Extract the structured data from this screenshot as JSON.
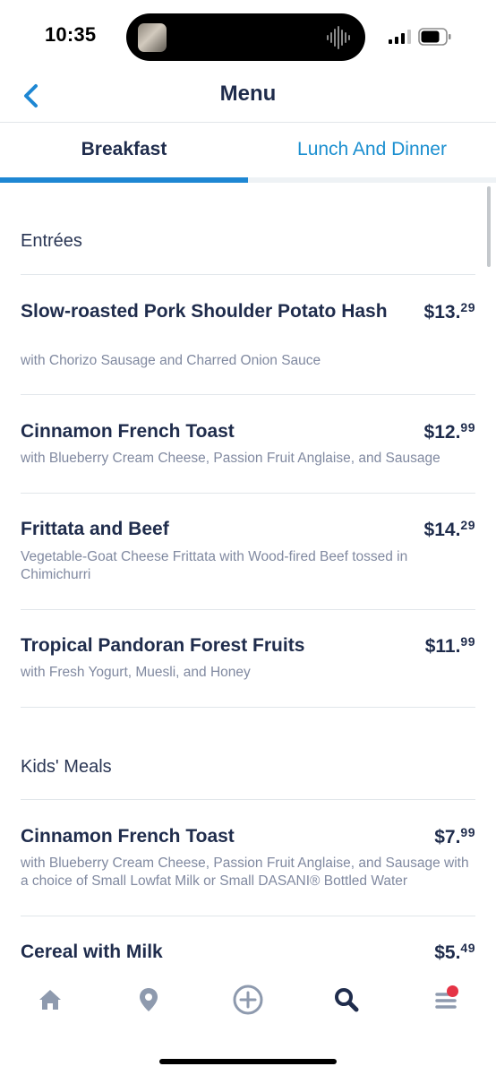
{
  "status_bar": {
    "time": "10:35"
  },
  "header": {
    "title": "Menu"
  },
  "tabs": [
    {
      "label": "Breakfast",
      "selected": true
    },
    {
      "label": "Lunch And Dinner",
      "selected": false
    }
  ],
  "sections": [
    {
      "heading": "Entrées",
      "items": [
        {
          "name": "Slow-roasted Pork Shoulder Potato Hash",
          "price_dollars": "$13.",
          "price_cents": "29",
          "description": "with Chorizo Sausage and Charred Onion Sauce"
        },
        {
          "name": "Cinnamon French Toast",
          "price_dollars": "$12.",
          "price_cents": "99",
          "description": "with Blueberry Cream Cheese, Passion Fruit Anglaise, and Sausage"
        },
        {
          "name": "Frittata and Beef",
          "price_dollars": "$14.",
          "price_cents": "29",
          "description": "Vegetable-Goat Cheese Frittata with Wood-fired Beef tossed in Chimichurri"
        },
        {
          "name": "Tropical Pandoran Forest Fruits",
          "price_dollars": "$11.",
          "price_cents": "99",
          "description": "with Fresh Yogurt, Muesli, and Honey"
        }
      ]
    },
    {
      "heading": "Kids' Meals",
      "items": [
        {
          "name": "Cinnamon French Toast",
          "price_dollars": "$7.",
          "price_cents": "99",
          "description": "with Blueberry Cream Cheese, Passion Fruit Anglaise, and Sausage with a choice of Small Lowfat Milk or Small DASANI® Bottled Water"
        },
        {
          "name": "Cereal with Milk",
          "price_dollars": "$5.",
          "price_cents": "49",
          "description": ""
        }
      ]
    }
  ],
  "tab_bar": {
    "items": [
      {
        "icon": "home-icon",
        "active": false
      },
      {
        "icon": "location-pin-icon",
        "active": false
      },
      {
        "icon": "plus-circle-icon",
        "active": false
      },
      {
        "icon": "search-icon",
        "active": true
      },
      {
        "icon": "menu-icon",
        "active": false,
        "has_notification": true
      }
    ]
  },
  "colors": {
    "accent": "#1e87d3",
    "text_primary": "#1f2c4c",
    "text_secondary": "#8089a0",
    "icon_inactive": "#8e9aae",
    "notification": "#e53345"
  }
}
